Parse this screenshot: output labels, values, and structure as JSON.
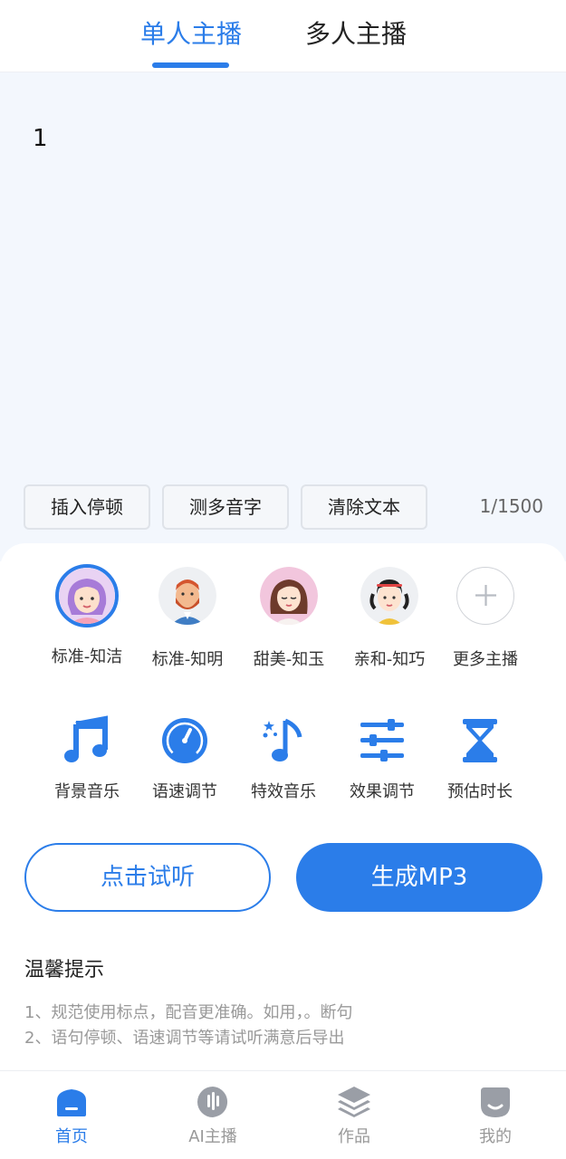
{
  "tabs": [
    {
      "label": "单人主播",
      "active": true
    },
    {
      "label": "多人主播",
      "active": false
    }
  ],
  "editor": {
    "text": "1",
    "char_count": "1/1500"
  },
  "tools": [
    "插入停顿",
    "测多音字",
    "清除文本"
  ],
  "anchors": [
    {
      "label": "标准-知洁",
      "selected": true
    },
    {
      "label": "标准-知明",
      "selected": false
    },
    {
      "label": "甜美-知玉",
      "selected": false
    },
    {
      "label": "亲和-知巧",
      "selected": false
    },
    {
      "label": "更多主播",
      "selected": false
    }
  ],
  "features": [
    {
      "label": "背景音乐",
      "icon": "music-note-icon"
    },
    {
      "label": "语速调节",
      "icon": "speed-gauge-icon"
    },
    {
      "label": "特效音乐",
      "icon": "sparkle-music-icon"
    },
    {
      "label": "效果调节",
      "icon": "sliders-icon"
    },
    {
      "label": "预估时长",
      "icon": "hourglass-icon"
    }
  ],
  "actions": {
    "listen": "点击试听",
    "generate": "生成MP3"
  },
  "tips": {
    "title": "温馨提示",
    "lines": [
      "1、规范使用标点，配音更准确。如用，。断句",
      "2、语句停顿、语速调节等请试听满意后导出"
    ]
  },
  "nav": [
    {
      "label": "首页",
      "active": true
    },
    {
      "label": "AI主播",
      "active": false
    },
    {
      "label": "作品",
      "active": false
    },
    {
      "label": "我的",
      "active": false
    }
  ],
  "colors": {
    "accent": "#2b7de9",
    "editor_bg": "#f3f7fd",
    "muted_text": "#999999"
  }
}
